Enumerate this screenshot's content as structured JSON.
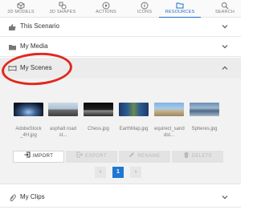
{
  "tabs": [
    {
      "label": "3D MODELS",
      "icon": "cube-icon",
      "active": false
    },
    {
      "label": "3D SHAPES",
      "icon": "shapes-icon",
      "active": false
    },
    {
      "label": "ACTIONS",
      "icon": "play-circle-icon",
      "active": false
    },
    {
      "label": "ICONS",
      "icon": "info-icon",
      "active": false
    },
    {
      "label": "RESOURCES",
      "icon": "folder-icon",
      "active": true
    },
    {
      "label": "SEARCH",
      "icon": "search-icon",
      "active": false
    }
  ],
  "sections": {
    "this_scenario": {
      "label": "This Scenario",
      "icon": "thumbs-up-icon"
    },
    "my_media": {
      "label": "My Media",
      "icon": "folder-icon"
    },
    "my_scenes": {
      "label": "My Scenes",
      "icon": "panorama-icon"
    },
    "my_clips": {
      "label": "My Clips",
      "icon": "paperclip-icon"
    }
  },
  "scenes": [
    {
      "caption": "AdobeStock\n_4H.jpg"
    },
    {
      "caption": "asphalt road\nst..."
    },
    {
      "caption": "Chess.jpg"
    },
    {
      "caption": "EarthMap.jpg"
    },
    {
      "caption": "equirect_sand\ndst..."
    },
    {
      "caption": "Spheres.jpg"
    }
  ],
  "actions": {
    "import": "IMPORT",
    "export": "EXPORT",
    "rename": "RENAME",
    "delete": "DELETE"
  },
  "pagination": {
    "prev": "‹",
    "current": "1",
    "next": "›"
  },
  "colors": {
    "accent": "#1e78d2",
    "annotation": "#e0281e"
  }
}
